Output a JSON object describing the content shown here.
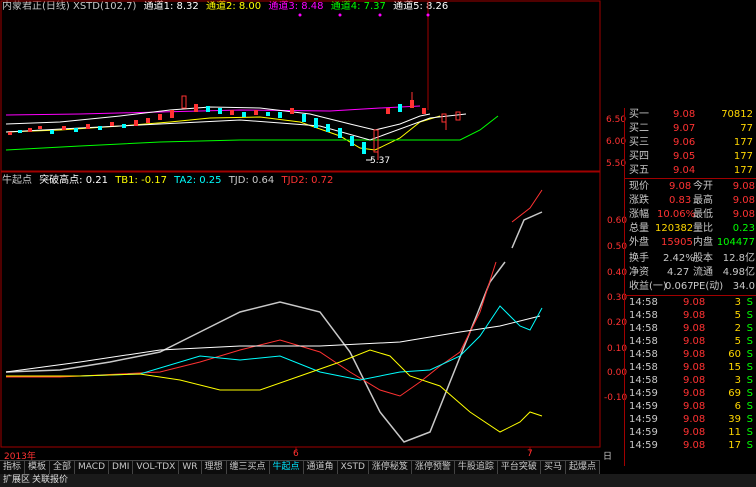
{
  "colors": {
    "bg": "#000000",
    "frame": "#a00000",
    "up": "#ff3232",
    "down": "#00ffff",
    "ch1": "#ffffff",
    "ch2": "#ffff00",
    "ch3": "#ff00ff",
    "ch4": "#00ff00",
    "ch5": "#ffffff",
    "label": "#c8c8c8",
    "price_red": "#ff3232",
    "price_green": "#00ff00",
    "gold": "#ffd700"
  },
  "top_legend": {
    "title": "内蒙君正(日线) XSTD(102,7)",
    "items": [
      {
        "label": "通道1: 8.32",
        "color": "#ffffff"
      },
      {
        "label": "通道2: 8.00",
        "color": "#ffff00"
      },
      {
        "label": "通道3: 8.48",
        "color": "#ff00ff"
      },
      {
        "label": "通道4: 7.37",
        "color": "#00ff00"
      },
      {
        "label": "通道5: 8.26",
        "color": "#ffffff"
      }
    ]
  },
  "price_axis": [
    "6.50",
    "6.00",
    "5.50"
  ],
  "low_marker": "5.37",
  "indicator_legend": {
    "items": [
      {
        "label": "牛起点",
        "color": "#c8c8c8"
      },
      {
        "label": "突破高点: 0.21",
        "color": "#ffffff"
      },
      {
        "label": "TB1: -0.17",
        "color": "#ffff00"
      },
      {
        "label": "TA2: 0.25",
        "color": "#00ffff"
      },
      {
        "label": "TJD: 0.64",
        "color": "#c8c8c8"
      },
      {
        "label": "TJD2: 0.72",
        "color": "#ff3232"
      }
    ]
  },
  "indicator_axis": [
    "0.60",
    "0.50",
    "0.40",
    "0.30",
    "0.20",
    "0.10",
    "0.00",
    "-0.10"
  ],
  "date_axis": {
    "year": "2013年",
    "m1": "6",
    "m2": "7"
  },
  "order_book": [
    {
      "label": "买一",
      "price": "9.08",
      "vol": "70812"
    },
    {
      "label": "买二",
      "price": "9.07",
      "vol": "77"
    },
    {
      "label": "买三",
      "price": "9.06",
      "vol": "177"
    },
    {
      "label": "买四",
      "price": "9.05",
      "vol": "177"
    },
    {
      "label": "买五",
      "price": "9.04",
      "vol": "177"
    }
  ],
  "quote": {
    "r1": {
      "l1": "现价",
      "v1": "9.08",
      "l2": "今开",
      "v2": "9.08"
    },
    "r2": {
      "l1": "涨跌",
      "v1": "0.83",
      "l2": "最高",
      "v2": "9.08"
    },
    "r3": {
      "l1": "涨幅",
      "v1": "10.06%",
      "l2": "最低",
      "v2": "9.08"
    },
    "r4": {
      "l1": "总量",
      "v1": "120382",
      "l2": "量比",
      "v2": "0.23"
    },
    "r5": {
      "l1": "外盘",
      "v1": "15905",
      "l2": "内盘",
      "v2": "104477"
    },
    "r6": {
      "l1": "换手",
      "v1": "2.42%",
      "l2": "股本",
      "v2": "12.8亿"
    },
    "r7": {
      "l1": "净资",
      "v1": "4.27",
      "l2": "流通",
      "v2": "4.98亿"
    },
    "r8": {
      "l1": "收益(一)",
      "v1": "0.067",
      "l2": "PE(动)",
      "v2": "34.0"
    }
  },
  "ticks": [
    {
      "time": "14:58",
      "price": "9.08",
      "vol": "3",
      "side": "S"
    },
    {
      "time": "14:58",
      "price": "9.08",
      "vol": "5",
      "side": "S"
    },
    {
      "time": "14:58",
      "price": "9.08",
      "vol": "2",
      "side": "S"
    },
    {
      "time": "14:58",
      "price": "9.08",
      "vol": "5",
      "side": "S"
    },
    {
      "time": "14:58",
      "price": "9.08",
      "vol": "60",
      "side": "S"
    },
    {
      "time": "14:58",
      "price": "9.08",
      "vol": "15",
      "side": "S"
    },
    {
      "time": "14:58",
      "price": "9.08",
      "vol": "3",
      "side": "S"
    },
    {
      "time": "14:59",
      "price": "9.08",
      "vol": "69",
      "side": "S"
    },
    {
      "time": "14:59",
      "price": "9.08",
      "vol": "6",
      "side": "S"
    },
    {
      "time": "14:59",
      "price": "9.08",
      "vol": "39",
      "side": "S"
    },
    {
      "time": "14:59",
      "price": "9.08",
      "vol": "11",
      "side": "S"
    },
    {
      "time": "14:59",
      "price": "9.08",
      "vol": "17",
      "side": "S"
    }
  ],
  "tabs": [
    "指标",
    "模板",
    "全部",
    "MACD",
    "DMI",
    "VOL-TDX",
    "WR",
    "理想",
    "缠三买点",
    "牛起点",
    "通道角",
    "XSTD",
    "涨停秘笈",
    "涨停预警",
    "牛股追踪",
    "平台突破",
    "买马",
    "起爆点"
  ],
  "status": {
    "left": "扩展区",
    "right": "关联报价"
  },
  "corner": "日"
}
